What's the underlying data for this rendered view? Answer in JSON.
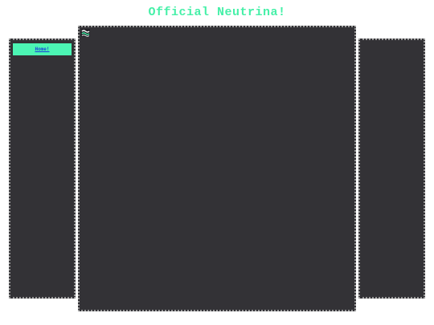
{
  "header": {
    "title": "Official Neutrina!"
  },
  "left_nav": {
    "items": [
      {
        "label": "Home!"
      }
    ]
  },
  "main": {
    "logo_icon": "neutrina-logo-icon"
  },
  "colors": {
    "accent": "#46f0a8",
    "panel_bg": "#333236",
    "link": "#1a3fd8",
    "page_bg": "#ffffff"
  }
}
